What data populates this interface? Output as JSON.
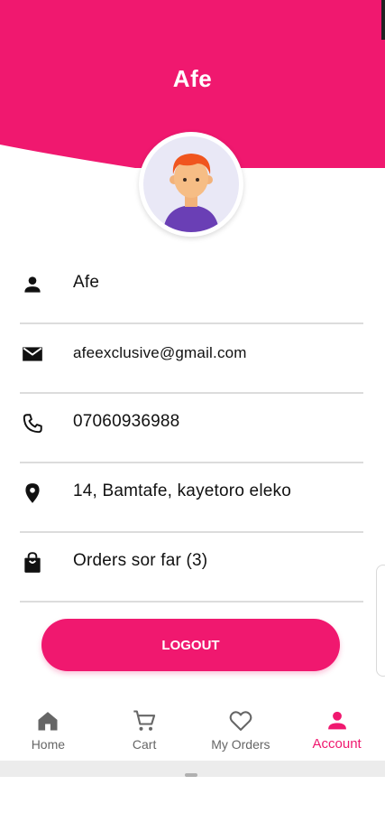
{
  "colors": {
    "accent": "#f0186f",
    "nav_inactive": "#666666",
    "divider": "#dcdcdc"
  },
  "profile": {
    "name": "Afe",
    "avatar_icon": "user-avatar-illustration"
  },
  "info": [
    {
      "icon": "person-icon",
      "value": "Afe"
    },
    {
      "icon": "mail-icon",
      "value": "afeexclusive@gmail.com"
    },
    {
      "icon": "phone-icon",
      "value": "07060936988"
    },
    {
      "icon": "location-pin-icon",
      "value": "14, Bamtafe, kayetoro eleko"
    },
    {
      "icon": "shopping-bag-icon",
      "value": "Orders sor far (3)"
    }
  ],
  "logout": {
    "label": "LOGOUT"
  },
  "nav": {
    "items": [
      {
        "label": "Home",
        "icon": "home-icon",
        "active": false
      },
      {
        "label": "Cart",
        "icon": "cart-icon",
        "active": false
      },
      {
        "label": "My Orders",
        "icon": "heart-icon",
        "active": false
      },
      {
        "label": "Account",
        "icon": "person-icon",
        "active": true
      }
    ]
  }
}
